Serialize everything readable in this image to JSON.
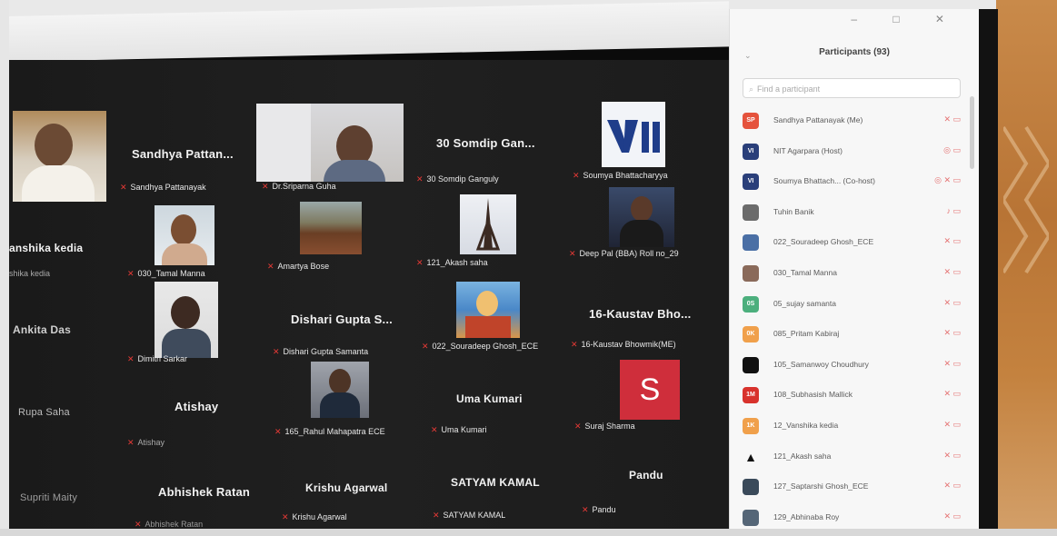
{
  "panel": {
    "title": "Participants (93)",
    "search_placeholder": "Find a participant",
    "participants": [
      {
        "name": "Sandhya Pattanayak (Me)",
        "avatar_text": "SP",
        "color": "#e5533d",
        "icons": "✕ ▭"
      },
      {
        "name": "NIT Agarpara (Host)",
        "avatar_text": "VI",
        "color": "#2a3f7a",
        "icons": "◎ ▭"
      },
      {
        "name": "Soumya Bhattach... (Co-host)",
        "avatar_text": "VI",
        "color": "#2a3f7a",
        "icons": "◎ ✕ ▭"
      },
      {
        "name": "Tuhin Banik",
        "avatar_text": "",
        "color": "#6b6b6b",
        "icons": "♪ ▭"
      },
      {
        "name": "022_Souradeep Ghosh_ECE",
        "avatar_text": "",
        "color": "#4a6fa5",
        "icons": "✕ ▭"
      },
      {
        "name": "030_Tamal Manna",
        "avatar_text": "",
        "color": "#8a6a5a",
        "icons": "✕ ▭"
      },
      {
        "name": "05_sujay samanta",
        "avatar_text": "0S",
        "color": "#4caf7d",
        "icons": "✕ ▭"
      },
      {
        "name": "085_Pritam Kabiraj",
        "avatar_text": "0K",
        "color": "#f0a04b",
        "icons": "✕ ▭"
      },
      {
        "name": "105_Samanwoy Choudhury",
        "avatar_text": "",
        "color": "#111111",
        "icons": "✕ ▭"
      },
      {
        "name": "108_Subhasish Mallick",
        "avatar_text": "1M",
        "color": "#d8322c",
        "icons": "✕ ▭"
      },
      {
        "name": "12_Vanshika kedia",
        "avatar_text": "1K",
        "color": "#f0a04b",
        "icons": "✕ ▭"
      },
      {
        "name": "121_Akash saha",
        "avatar_text": "▲",
        "color": "#f7f7f7",
        "icons": "✕ ▭"
      },
      {
        "name": "127_Saptarshi Ghosh_ECE",
        "avatar_text": "",
        "color": "#3a4a5a",
        "icons": "✕ ▭"
      },
      {
        "name": "129_Abhinaba Roy",
        "avatar_text": "",
        "color": "#556677",
        "icons": "✕ ▭"
      }
    ]
  },
  "gallery": {
    "tiles": [
      {
        "big": "",
        "caption": ""
      },
      {
        "big": "Sandhya  Pattan...",
        "caption": "Sandhya Pattanayak"
      },
      {
        "big": "",
        "caption": "Dr.Sriparna Guha"
      },
      {
        "big": "30 Somdip Gan...",
        "caption": "30 Somdip Ganguly"
      },
      {
        "big": "",
        "caption": "Soumya Bhattacharyya"
      },
      {
        "big": "anshika kedia",
        "caption": "shika kedia"
      },
      {
        "big": "",
        "caption": "030_Tamal Manna"
      },
      {
        "big": "",
        "caption": "Amartya Bose"
      },
      {
        "big": "",
        "caption": "121_Akash saha"
      },
      {
        "big": "",
        "caption": "Deep Pal (BBA) Roll no_29"
      },
      {
        "big": "Ankita Das",
        "caption": ""
      },
      {
        "big": "",
        "caption": "Dimitri Sarkar"
      },
      {
        "big": "Dishari Gupta S...",
        "caption": "Dishari Gupta Samanta"
      },
      {
        "big": "",
        "caption": "022_Souradeep Ghosh_ECE"
      },
      {
        "big": "16-Kaustav Bho...",
        "caption": "16-Kaustav Bhowmik(ME)"
      },
      {
        "big": "Rupa Saha",
        "caption": ""
      },
      {
        "big": "Atishay",
        "caption": "Atishay"
      },
      {
        "big": "",
        "caption": "165_Rahul Mahapatra ECE"
      },
      {
        "big": "Uma Kumari",
        "caption": "Uma Kumari"
      },
      {
        "big": "",
        "caption": "Suraj Sharma"
      },
      {
        "big": "Supriti Maity",
        "caption": ""
      },
      {
        "big": "Abhishek Ratan",
        "caption": "Abhishek Ratan"
      },
      {
        "big": "Krishu Agarwal",
        "caption": "Krishu Agarwal"
      },
      {
        "big": "SATYAM KAMAL",
        "caption": "SATYAM KAMAL"
      },
      {
        "big": "Pandu",
        "caption": "Pandu"
      }
    ],
    "s_letter": "S"
  },
  "window": {
    "controls": "– □ ✕"
  }
}
